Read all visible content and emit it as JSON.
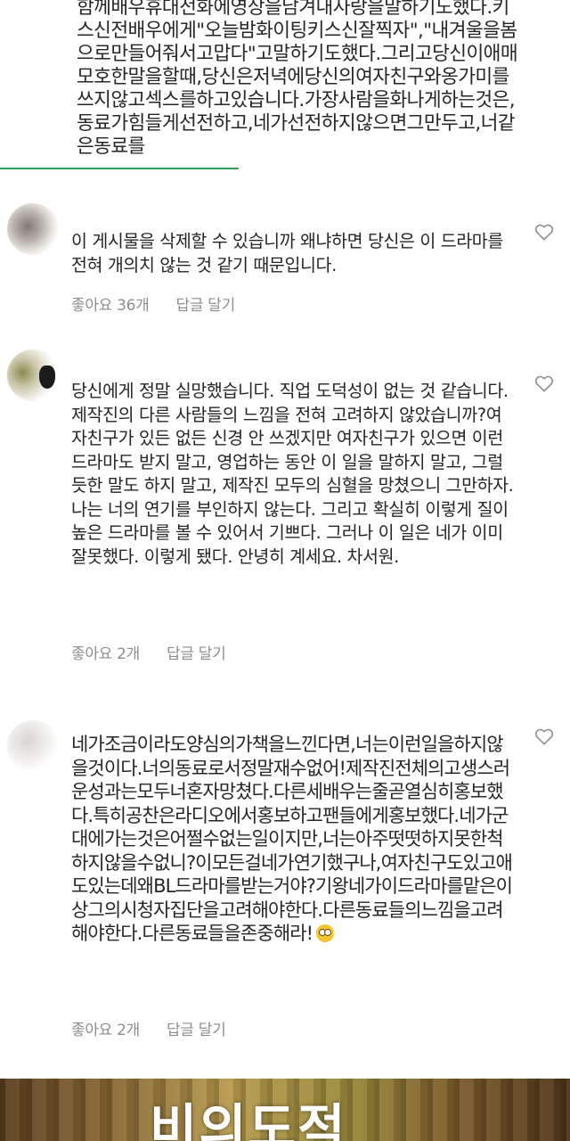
{
  "top_comment": {
    "text": "함께배우휴대전화에영상을남겨내사랑을말하기도했다.키스신전배우에게\"오늘밤화이팅키스신잘찍자\",\"내겨울을봄으로만들어줘서고맙다\"고말하기도했다.그리고당신이애매모호한말을할때,당신은저녁에당신의여자친구와옹가미를쓰지않고섹스를하고있습니다.가장사람을화나게하는것은,동료가힘들게선전하고,네가선전하지않으면그만두고,너같은동료를"
  },
  "comments": [
    {
      "text": "이 게시물을 삭제할 수 있습니까 왜냐하면 당신은 이 드라마를 전혀 개의치 않는 것 같기 때문입니다.",
      "likes": "좋아요 36개",
      "reply": "답글 달기"
    },
    {
      "text": "당신에게 정말 실망했습니다. 직업 도덕성이 없는 것 같습니다. 제작진의 다른 사람들의 느낌을 전혀 고려하지 않았습니까?여자친구가 있든 없든 신경 안 쓰겠지만 여자친구가 있으면 이런 드라마도 받지 말고, 영업하는 동안 이 일을 말하지 말고, 그럴듯한 말도 하지 말고, 제작진 모두의 심혈을 망쳤으니 그만하자. 나는 너의 연기를 부인하지 않는다. 그리고 확실히 이렇게 질이 높은 드라마를 볼 수 있어서 기쁘다. 그러나 이 일은 네가 이미 잘못했다. 이렇게 됐다. 안녕히 계세요. 차서원.",
      "likes": "좋아요 2개",
      "reply": "답글 달기"
    },
    {
      "text": "네가조금이라도양심의가책을느낀다면,너는이런일을하지않을것이다.너의동료로서정말재수없어!제작진전체의고생스러운성과는모두너혼자망쳤다.다른세배우는줄곧열심히홍보했다.특히공찬은라디오에서홍보하고팬들에게홍보했다.네가군대에가는것은어쩔수없는일이지만,너는아주떳떳하지못한척하지않을수없니?이모든걸네가연기했구나,여자친구도있고애도있는데왜BL드라마를받는거야?기왕네가이드라마를맡은이상그의시청자집단을고려해야한다.다른동료들의느낌을고려해야한다.다른동료들을존중해라!",
      "likes": "좋아요 2개",
      "reply": "답글 달기"
    }
  ],
  "banner": {
    "title": "비의도적"
  },
  "colors": {
    "text": "#262626",
    "meta": "#8e8e8e",
    "accent_line": "#2f9e5b"
  },
  "icons": {
    "heart": "heart-outline-icon",
    "emoji": "rolling-eyes-emoji"
  }
}
